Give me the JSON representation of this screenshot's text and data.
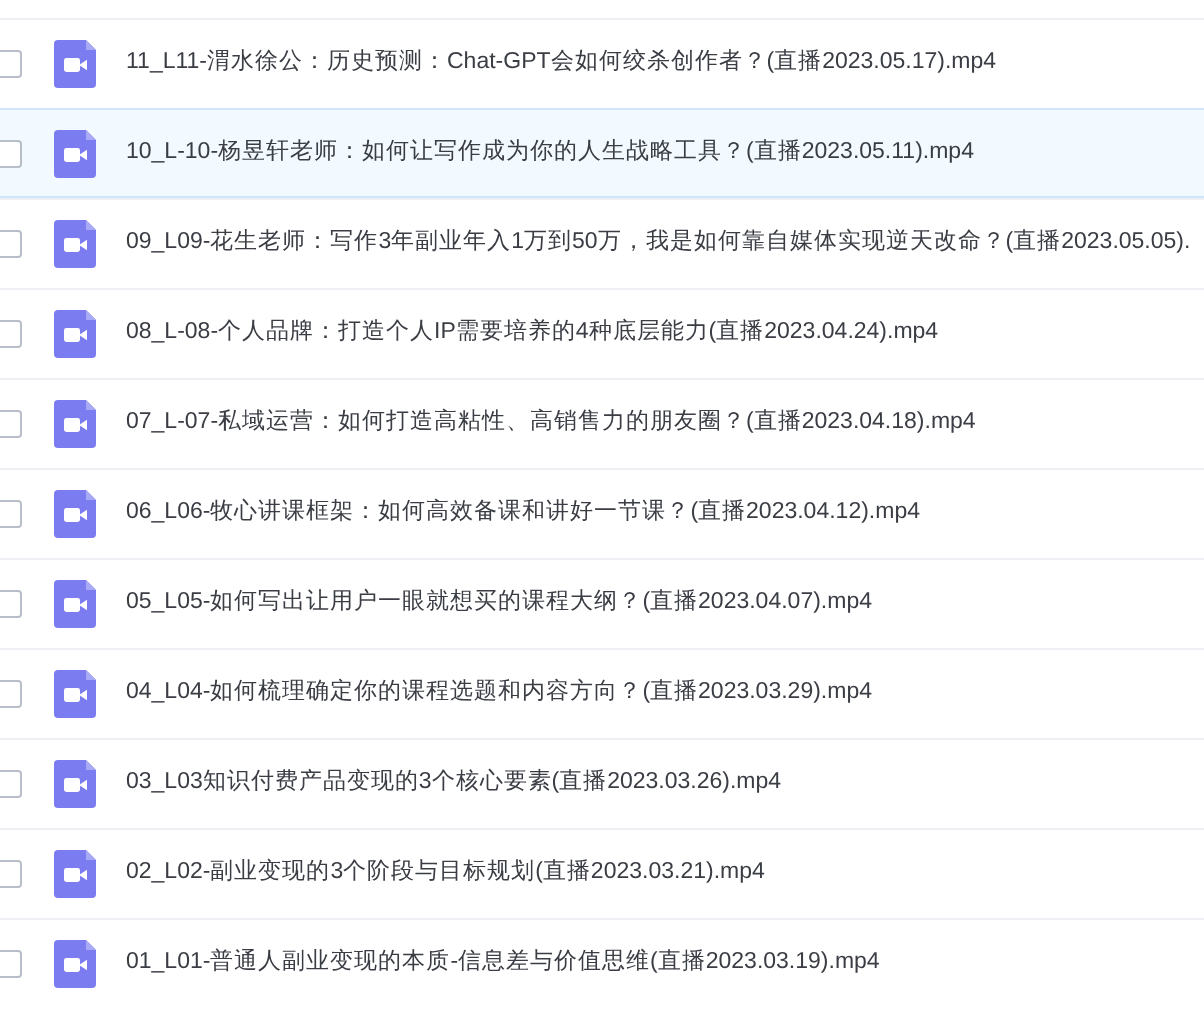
{
  "files": [
    {
      "name": "11_L11-渭水徐公：历史预测：Chat-GPT会如何绞杀创作者？(直播2023.05.17).mp4",
      "selected": false
    },
    {
      "name": "10_L-10-杨昱轩老师：如何让写作成为你的人生战略工具？(直播2023.05.11).mp4",
      "selected": true
    },
    {
      "name": "09_L09-花生老师：写作3年副业年入1万到50万，我是如何靠自媒体实现逆天改命？(直播2023.05.05).",
      "selected": false
    },
    {
      "name": "08_L-08-个人品牌：打造个人IP需要培养的4种底层能力(直播2023.04.24).mp4",
      "selected": false
    },
    {
      "name": "07_L-07-私域运营：如何打造高粘性、高销售力的朋友圈？(直播2023.04.18).mp4",
      "selected": false
    },
    {
      "name": "06_L06-牧心讲课框架：如何高效备课和讲好一节课？(直播2023.04.12).mp4",
      "selected": false
    },
    {
      "name": "05_L05-如何写出让用户一眼就想买的课程大纲？(直播2023.04.07).mp4",
      "selected": false
    },
    {
      "name": "04_L04-如何梳理确定你的课程选题和内容方向？(直播2023.03.29).mp4",
      "selected": false
    },
    {
      "name": "03_L03知识付费产品变现的3个核心要素(直播2023.03.26).mp4",
      "selected": false
    },
    {
      "name": "02_L02-副业变现的3个阶段与目标规划(直播2023.03.21).mp4",
      "selected": false
    },
    {
      "name": "01_L01-普通人副业变现的本质-信息差与价值思维(直播2023.03.19).mp4",
      "selected": false
    }
  ]
}
